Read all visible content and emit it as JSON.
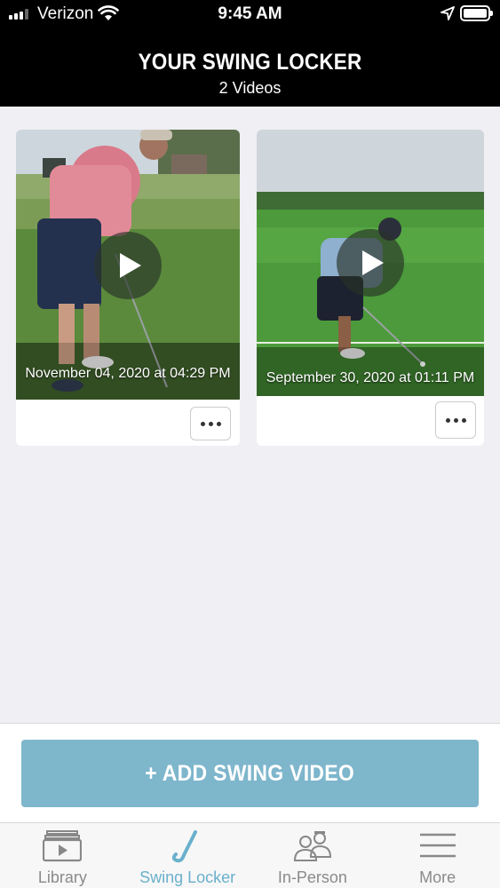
{
  "status_bar": {
    "carrier": "Verizon",
    "time": "9:45 AM",
    "icons": [
      "signal-icon",
      "wifi-icon",
      "location-icon",
      "battery-icon"
    ]
  },
  "header": {
    "title": "YOUR SWING LOCKER",
    "subtitle": "2 Videos"
  },
  "videos": [
    {
      "date": "November 04, 2020 at 04:29 PM",
      "icon": "play-icon",
      "menu_icon": "more-options-icon"
    },
    {
      "date": "September 30, 2020 at 01:11 PM",
      "icon": "play-icon",
      "menu_icon": "more-options-icon"
    }
  ],
  "action": {
    "add_label": "+ ADD SWING VIDEO"
  },
  "tabs": [
    {
      "label": "Library",
      "icon": "video-library-icon",
      "active": false
    },
    {
      "label": "Swing Locker",
      "icon": "golf-club-icon",
      "active": true
    },
    {
      "label": "In-Person",
      "icon": "people-icon",
      "active": false
    },
    {
      "label": "More",
      "icon": "hamburger-menu-icon",
      "active": false
    }
  ],
  "colors": {
    "accent": "#7eb6cc",
    "active_tab": "#6ab0cc",
    "header_bg": "#000000",
    "page_bg": "#efeff4"
  }
}
